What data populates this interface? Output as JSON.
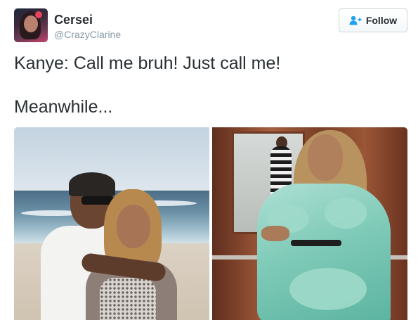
{
  "tweet": {
    "author": {
      "display_name": "Cersei",
      "handle": "@CrazyClarine"
    },
    "follow_button_label": "Follow",
    "follow_icon": "follow-user-icon",
    "text_lines": [
      "Kanye: Call me bruh! Just call me!",
      "Meanwhile..."
    ]
  },
  "colors": {
    "text": "#292f33",
    "handle": "#8899a6",
    "accent": "#1da1f2",
    "button_border": "#d0d6da"
  }
}
